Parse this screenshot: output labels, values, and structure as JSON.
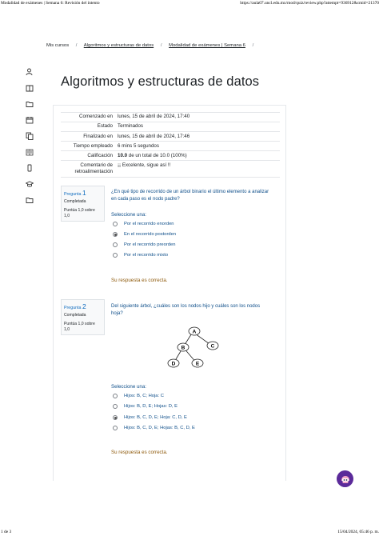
{
  "print_header": {
    "left": "Modalidad de exámenes | Semana 6: Revisión del intento",
    "right": "https://aula07.uncl.edu.mx/mod/quiz/review.php?attempt=936912&cmid=21370"
  },
  "print_footer": {
    "left": "1 de 3",
    "right": "15/04/2024, 05:46 p. m."
  },
  "rail_icons": [
    "user-shield-icon",
    "book-icon",
    "folder-icon",
    "calendar-icon",
    "copy-icon",
    "book-open-icon",
    "mobile-icon",
    "graduation-cap-icon",
    "folder-icon"
  ],
  "breadcrumb": [
    "Mis cursos",
    "Algoritmos y estructuras de datos",
    "Modalidad de exámenes | Semana 6"
  ],
  "page_title": "Algoritmos y estructuras de datos",
  "summary": [
    {
      "label": "Comenzado en",
      "value": "lunes, 15 de abril de 2024, 17:40"
    },
    {
      "label": "Estado",
      "value": "Terminados"
    },
    {
      "label": "Finalizado en",
      "value": "lunes, 15 de abril de 2024, 17:46"
    },
    {
      "label": "Tiempo empleado",
      "value": "6 mins 5 segundos"
    },
    {
      "label": "Calificación",
      "value_bold": "10.0",
      "value": " de un total de 10.0 (100%)"
    },
    {
      "label": "Comentario de retroalimentación",
      "value": "¡¡ Excelente, sigue así !!"
    }
  ],
  "questions": [
    {
      "pregunta": "Pregunta",
      "number": "1",
      "state": "Completada",
      "grade": "Puntúa 1,0 sobre 1,0",
      "text": "¿En qué tipo de recorrido de un árbol binario el último elemento a analizar en cada paso es el nodo padre?",
      "prompt": "Seleccione una:",
      "options": [
        "Por el recorrido enorden",
        "En el recorrido postorden",
        "Por el recorrido preorden",
        "Por el recorrido mixto"
      ],
      "selected": 1,
      "feedback": "Su respuesta es correcta."
    },
    {
      "pregunta": "Pregunta",
      "number": "2",
      "state": "Completada",
      "grade": "Puntúa 1,0 sobre 1,0",
      "text": "Del siguiente árbol, ¿cuáles son los nodos hijo y cuáles son los nodos hoja?",
      "tree_nodes": [
        "A",
        "B",
        "C",
        "D",
        "E"
      ],
      "prompt": "Seleccione una:",
      "options": [
        "Hijos: B, C; Hoja: C",
        "Hijos: B, D, E; Hojas: D, E",
        "Hijos: B, C, D, E; Hoja: C, D, E",
        "Hijos: B, C, D, E; Hojas: B, C, D, E"
      ],
      "selected": 2,
      "feedback": "Su respuesta es correcta."
    }
  ],
  "help_icon": "moodle-help-icon",
  "colors": {
    "link": "#0f6cbf",
    "question_text": "#0f4f8a",
    "feedback": "#8e5a0c",
    "info_bg": "#f8f9fa",
    "fab": "#5b2a9a"
  }
}
